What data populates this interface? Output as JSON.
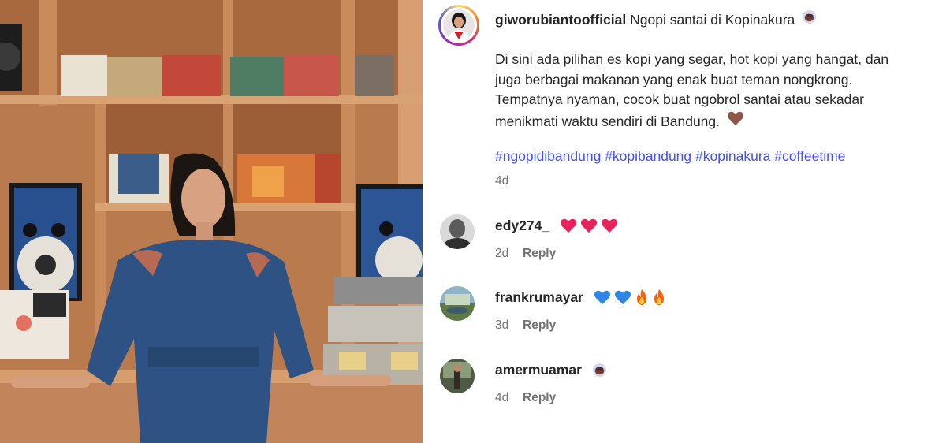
{
  "post": {
    "author": "giworubiantoofficial",
    "caption_head": "Ngopi santai di Kopinakura",
    "caption_lines": [
      "Di sini ada pilihan es kopi yang segar, hot kopi yang hangat, dan",
      "juga berbagai makanan yang enak buat teman nongkrong.",
      "Tempatnya nyaman, cocok buat ngobrol santai atau sekadar",
      "menikmati waktu sendiri di Bandung."
    ],
    "hashtags": [
      "#ngopidibandung",
      "#kopibandung",
      "#kopinakura",
      "#coffeetime"
    ],
    "time": "4d",
    "emoji": {
      "coffee": "coffee-cup-icon",
      "heart": "brown-heart-icon"
    }
  },
  "comments": [
    {
      "user": "edy274_",
      "time": "2d",
      "reply": "Reply",
      "emoji": [
        "red-heart-icon",
        "red-heart-icon",
        "red-heart-icon"
      ]
    },
    {
      "user": "frankrumayar",
      "time": "3d",
      "reply": "Reply",
      "emoji": [
        "blue-heart-icon",
        "blue-heart-icon",
        "fire-icon",
        "fire-icon"
      ]
    },
    {
      "user": "amermuamar",
      "time": "4d",
      "reply": "Reply",
      "emoji": [
        "coffee-cup-icon"
      ]
    }
  ],
  "colors": {
    "hashtag": "#4150f7",
    "muted": "#737373",
    "text": "#262626"
  }
}
